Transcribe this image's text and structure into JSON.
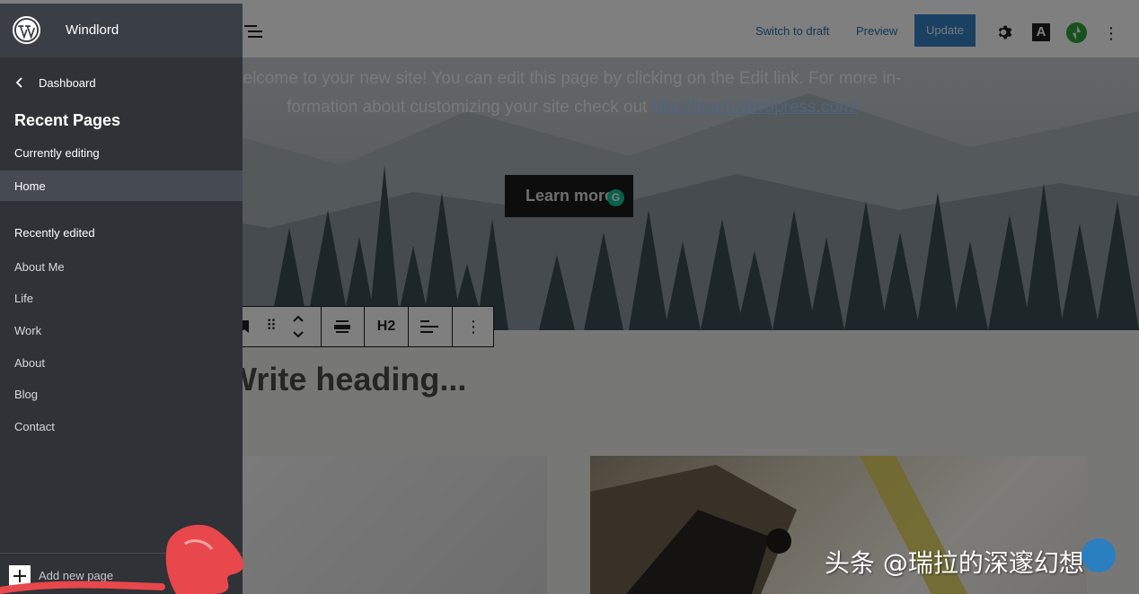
{
  "topbar": {
    "switch_to_draft": "Switch to draft",
    "preview": "Preview",
    "update": "Update",
    "styles_glyph": "A"
  },
  "canvas": {
    "hero_text_prefix": "elcome to your new site! You can edit this page by clicking on the Edit link. For more in-formation about customizing your site check out",
    "hero_link": "http://learn.wordpress.com/",
    "learn_more": "Learn more",
    "grammarly_glyph": "G",
    "heading_placeholder": "Write heading..."
  },
  "block_toolbar": {
    "heading_level": "H2"
  },
  "sidebar": {
    "site_title": "Windlord",
    "back_label": "Dashboard",
    "title": "Recent Pages",
    "currently_editing_label": "Currently editing",
    "current_page": "Home",
    "recently_edited_label": "Recently edited",
    "recent_items": [
      "About Me",
      "Life",
      "Work",
      "About",
      "Blog",
      "Contact"
    ],
    "add_new_page": "Add new page"
  },
  "watermark": "头条 @瑞拉的深邃幻想",
  "colors": {
    "sidebar_bg": "#2f3237",
    "sidebar_active": "#464b53",
    "accent_blue": "#2271b1",
    "update_button": "#3582c4",
    "jetpack_green": "#2ea53a",
    "red_annotation": "#e8474b"
  },
  "icons": {
    "logo": "wordpress-logo-icon",
    "list_view": "list-view-icon",
    "settings": "gear-icon",
    "styles": "styles-icon",
    "jetpack": "jetpack-icon",
    "more": "more-vertical-icon",
    "back": "chevron-left-icon",
    "add": "plus-icon"
  }
}
